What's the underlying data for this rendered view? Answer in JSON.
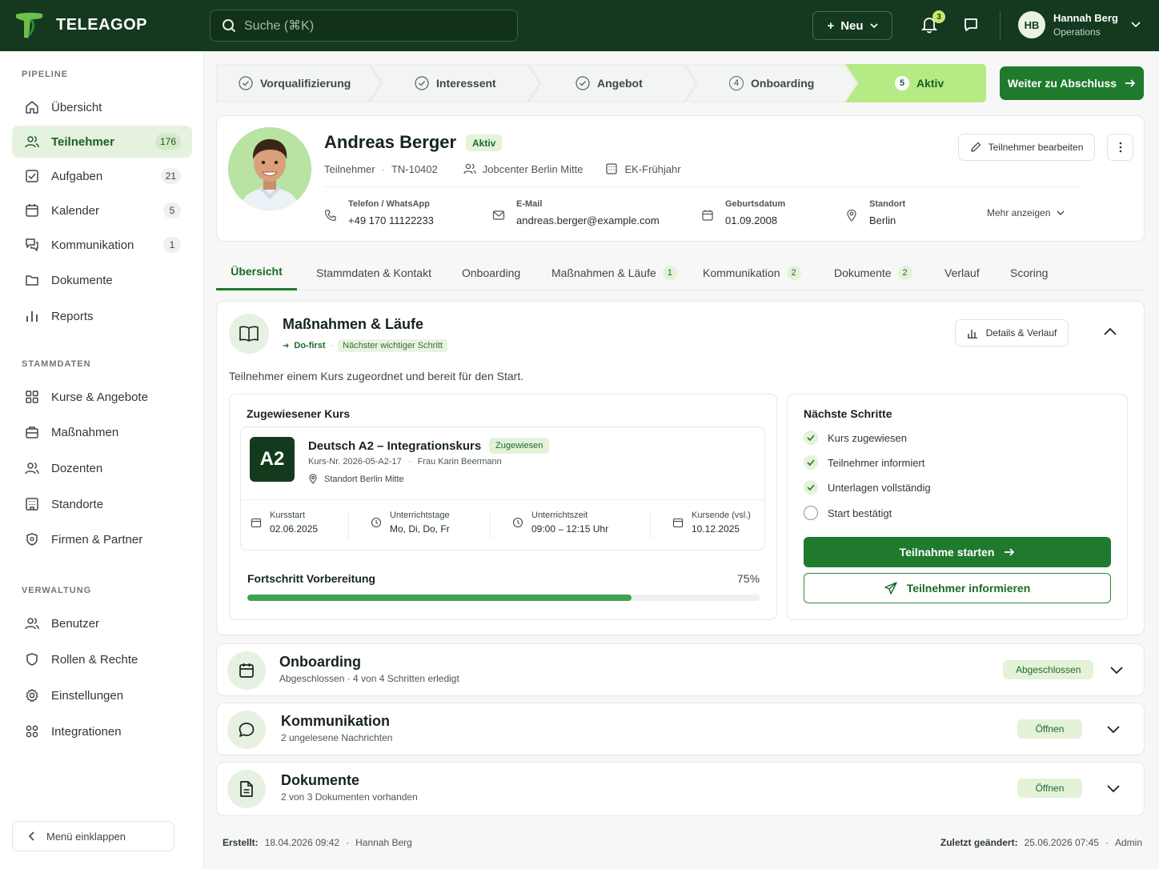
{
  "app": {
    "name": "TELEAGOP"
  },
  "search": {
    "placeholder": "Suche (⌘K)"
  },
  "header": {
    "new_label": "Neu",
    "notifications_count": "3",
    "user": {
      "initials": "HB",
      "name": "Hannah Berg",
      "role": "Operations"
    }
  },
  "sidebar": {
    "sections": {
      "pipeline": "PIPELINE",
      "stammdaten": "STAMMDATEN",
      "verwaltung": "VERWALTUNG"
    },
    "pipeline_items": [
      {
        "label": "Übersicht",
        "icon": "home-icon"
      },
      {
        "label": "Teilnehmer",
        "count": "176",
        "icon": "users-icon"
      },
      {
        "label": "Aufgaben",
        "count": "21",
        "icon": "checkbox-icon"
      },
      {
        "label": "Kalender",
        "count": "5",
        "icon": "calendar-icon"
      },
      {
        "label": "Kommunikation",
        "count": "1",
        "icon": "chat-icon"
      },
      {
        "label": "Dokumente",
        "icon": "folder-icon"
      },
      {
        "label": "Reports",
        "icon": "bar-chart-icon"
      }
    ],
    "stammdaten_items": [
      {
        "label": "Kurse & Angebote",
        "icon": "grid-icon"
      },
      {
        "label": "Maßnahmen",
        "icon": "briefcase-icon"
      },
      {
        "label": "Dozenten",
        "icon": "people-icon"
      },
      {
        "label": "Standorte",
        "icon": "building-icon"
      },
      {
        "label": "Firmen & Partner",
        "icon": "shield-icon"
      }
    ],
    "verwaltung_items": [
      {
        "label": "Benutzer",
        "icon": "users-icon"
      },
      {
        "label": "Rollen & Rechte",
        "icon": "shield-icon"
      },
      {
        "label": "Einstellungen",
        "icon": "gear-icon"
      },
      {
        "label": "Integrationen",
        "icon": "integrations-icon"
      }
    ],
    "collapse_label": "Menü einklappen"
  },
  "stepper": {
    "steps": [
      {
        "label": "Vorqualifizierung",
        "marker": "✓"
      },
      {
        "label": "Interessent",
        "marker": "✓"
      },
      {
        "label": "Angebot",
        "marker": "✓"
      },
      {
        "label": "Onboarding",
        "marker": "4"
      },
      {
        "label": "Aktiv",
        "marker": "5"
      }
    ],
    "next_button": "Weiter zu Abschluss"
  },
  "profile": {
    "name": "Andreas Berger",
    "status": "Aktiv",
    "role": "Teilnehmer",
    "id": "TN-10402",
    "jobcenter": "Jobcenter Berlin Mitte",
    "cohort": "EK-Frühjahr",
    "edit_button": "Teilnehmer bearbeiten",
    "more_label": "Mehr anzeigen",
    "fields": [
      {
        "label": "Telefon / WhatsApp",
        "value": "+49 170 11122233"
      },
      {
        "label": "E-Mail",
        "value": "andreas.berger@example.com"
      },
      {
        "label": "Geburtsdatum",
        "value": "01.09.2008"
      },
      {
        "label": "Standort",
        "value": "Berlin"
      }
    ]
  },
  "tabs": [
    {
      "label": "Übersicht"
    },
    {
      "label": "Stammdaten & Kontakt"
    },
    {
      "label": "Onboarding"
    },
    {
      "label": "Maßnahmen & Läufe",
      "count": "1"
    },
    {
      "label": "Kommunikation",
      "count": "2"
    },
    {
      "label": "Dokumente",
      "count": "2"
    },
    {
      "label": "Verlauf"
    },
    {
      "label": "Scoring"
    }
  ],
  "massnahmen": {
    "title": "Maßnahmen & Läufe",
    "do_first": "Do-first",
    "next_hint": "Nächster wichtiger Schritt",
    "details_button": "Details & Verlauf",
    "description": "Teilnehmer einem Kurs zugeordnet und bereit für den Start.",
    "course_box_title": "Zugewiesener Kurs",
    "course": {
      "level": "A2",
      "title": "Deutsch A2 – Integrationskurs",
      "status": "Zugewiesen",
      "number": "Kurs-Nr. 2026-05-A2-17",
      "teacher": "Frau Karin Beermann",
      "location": "Standort Berlin Mitte",
      "facts": [
        {
          "label": "Kursstart",
          "value": "02.06.2025"
        },
        {
          "label": "Unterrichtstage",
          "value": "Mo, Di, Do, Fr"
        },
        {
          "label": "Unterrichtszeit",
          "value": "09:00 – 12:15 Uhr"
        },
        {
          "label": "Kursende (vsl.)",
          "value": "10.12.2025"
        }
      ]
    },
    "progress": {
      "label": "Fortschritt Vorbereitung",
      "percent_text": "75%",
      "value": 0.75
    },
    "next_steps": {
      "title": "Nächste Schritte",
      "items": [
        {
          "label": "Kurs zugewiesen",
          "done": true
        },
        {
          "label": "Teilnehmer informiert",
          "done": true
        },
        {
          "label": "Unterlagen vollständig",
          "done": true
        },
        {
          "label": "Start bestätigt",
          "done": false
        }
      ],
      "primary_button": "Teilnahme starten",
      "secondary_button": "Teilnehmer informieren"
    }
  },
  "sections": [
    {
      "title": "Onboarding",
      "subtitle": "Abgeschlossen · 4 von 4 Schritten erledigt",
      "status": "Abgeschlossen"
    },
    {
      "title": "Kommunikation",
      "subtitle": "2 ungelesene Nachrichten",
      "status": "Öffnen"
    },
    {
      "title": "Dokumente",
      "subtitle": "2 von 3 Dokumenten vorhanden",
      "status": "Öffnen"
    }
  ],
  "footer": {
    "created_label": "Erstellt:",
    "created_value": "18.04.2026 09:42",
    "created_by": "Hannah Berg",
    "changed_label": "Zuletzt geändert:",
    "changed_value": "25.06.2026 07:45",
    "changed_by": "Admin"
  },
  "colors": {
    "brand_dark": "#14391f",
    "accent": "#1f7a2e",
    "accent_light": "#e3f2d9",
    "step_active": "#b6ea84"
  }
}
